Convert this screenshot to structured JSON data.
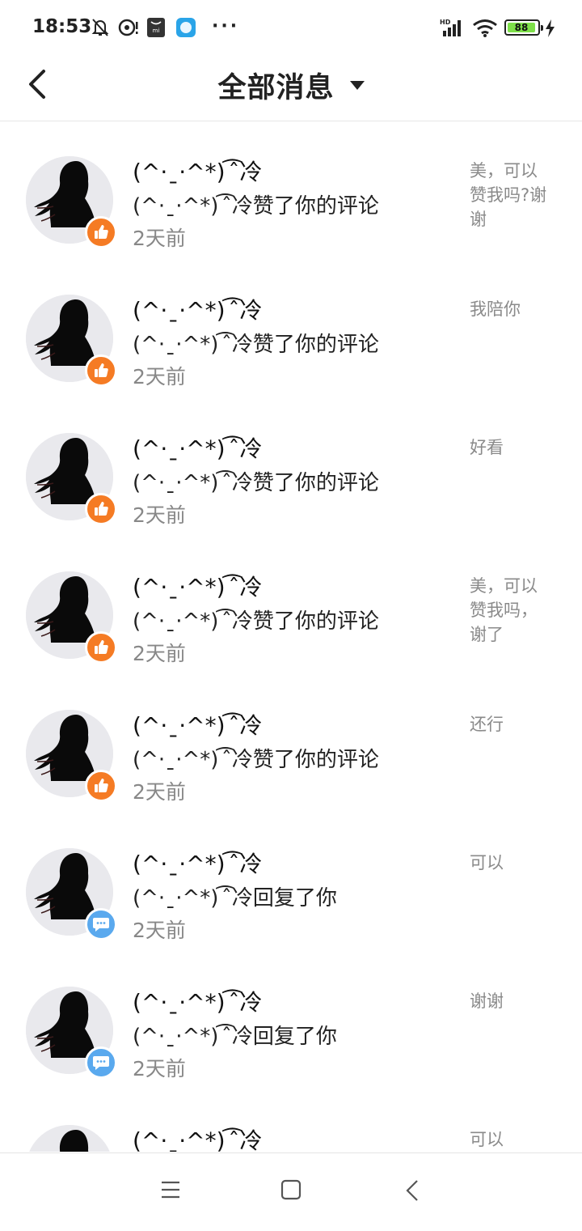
{
  "status_bar": {
    "time": "18:53",
    "battery_level": "88",
    "network": "HD"
  },
  "header": {
    "title": "全部消息"
  },
  "messages": [
    {
      "name": "(^·ˍ·^*) ͡ ̂冷",
      "action": "(^·ˍ·^*) ͡ ̂冷赞了你的评论",
      "time": "2天前",
      "preview": "美，可以赞我吗?谢谢",
      "badge": "like"
    },
    {
      "name": "(^·ˍ·^*) ͡ ̂冷",
      "action": "(^·ˍ·^*) ͡ ̂冷赞了你的评论",
      "time": "2天前",
      "preview": "我陪你",
      "badge": "like"
    },
    {
      "name": "(^·ˍ·^*) ͡ ̂冷",
      "action": "(^·ˍ·^*) ͡ ̂冷赞了你的评论",
      "time": "2天前",
      "preview": "好看",
      "badge": "like"
    },
    {
      "name": "(^·ˍ·^*) ͡ ̂冷",
      "action": "(^·ˍ·^*) ͡ ̂冷赞了你的评论",
      "time": "2天前",
      "preview": "美，可以赞我吗，谢了",
      "badge": "like"
    },
    {
      "name": "(^·ˍ·^*) ͡ ̂冷",
      "action": "(^·ˍ·^*) ͡ ̂冷赞了你的评论",
      "time": "2天前",
      "preview": "还行",
      "badge": "like"
    },
    {
      "name": "(^·ˍ·^*) ͡ ̂冷",
      "action": "(^·ˍ·^*) ͡ ̂冷回复了你",
      "time": "2天前",
      "preview": "可以",
      "badge": "reply"
    },
    {
      "name": "(^·ˍ·^*) ͡ ̂冷",
      "action": "(^·ˍ·^*) ͡ ̂冷回复了你",
      "time": "2天前",
      "preview": "谢谢",
      "badge": "reply"
    },
    {
      "name": "(^·ˍ·^*) ͡ ̂冷",
      "action": "",
      "time": "",
      "preview": "可以",
      "badge": "none"
    }
  ],
  "icons": {
    "back": "chevron-left-icon",
    "dropdown": "caret-down-icon",
    "like_badge": "thumbs-up-icon",
    "reply_badge": "chat-bubble-icon",
    "nav_menu": "menu-icon",
    "nav_home": "square-home-icon",
    "nav_back": "back-icon"
  },
  "colors": {
    "like_badge": "#f57b24",
    "reply_badge": "#5aa9ee",
    "secondary_text": "#888888"
  }
}
